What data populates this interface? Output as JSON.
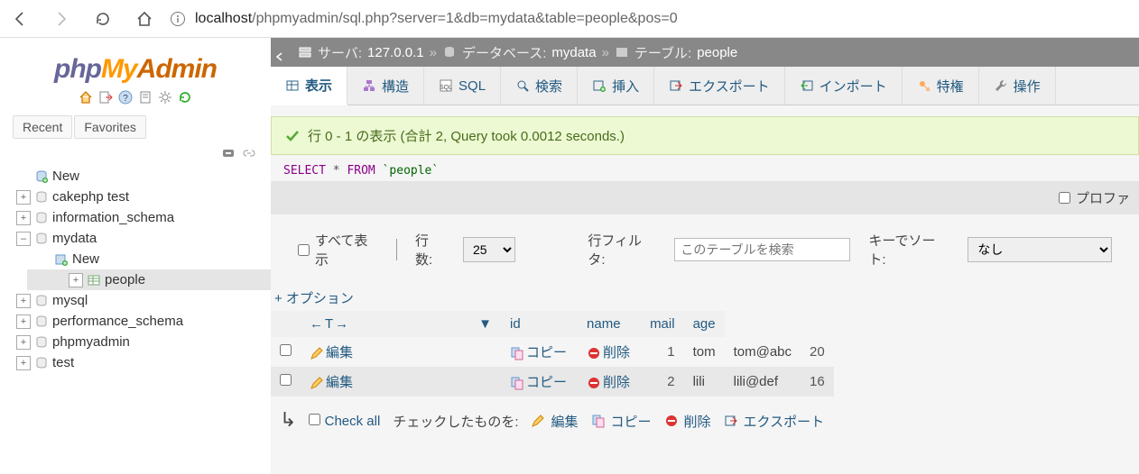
{
  "browser": {
    "url_prefix": "localhost",
    "url_rest": "/phpmyadmin/sql.php?server=1&db=mydata&table=people&pos=0"
  },
  "logo": {
    "part1": "php",
    "part2": "My",
    "part3": "Admin"
  },
  "rf_tabs": {
    "recent": "Recent",
    "favorites": "Favorites"
  },
  "tree": {
    "new": "New",
    "dbs": [
      {
        "name": "cakephp test",
        "expanded": false
      },
      {
        "name": "information_schema",
        "expanded": false
      },
      {
        "name": "mydata",
        "expanded": true,
        "children": {
          "new": "New",
          "tables": [
            "people"
          ]
        }
      },
      {
        "name": "mysql",
        "expanded": false
      },
      {
        "name": "performance_schema",
        "expanded": false
      },
      {
        "name": "phpmyadmin",
        "expanded": false
      },
      {
        "name": "test",
        "expanded": false
      }
    ]
  },
  "breadcrumb": {
    "server_label": "サーバ:",
    "server": "127.0.0.1",
    "db_label": "データベース:",
    "db": "mydata",
    "table_label": "テーブル:",
    "table": "people"
  },
  "tabs": {
    "browse": "表示",
    "structure": "構造",
    "sql": "SQL",
    "search": "検索",
    "insert": "挿入",
    "export": "エクスポート",
    "import": "インポート",
    "privileges": "特権",
    "operations": "操作"
  },
  "message": "行 0 - 1 の表示 (合計 2, Query took 0.0012 seconds.)",
  "sql": {
    "kw1": "SELECT",
    "star": "*",
    "kw2": "FROM",
    "table": "`people`"
  },
  "sqlfooter": {
    "profiling": "プロファ"
  },
  "controls": {
    "show_all": "すべて表示",
    "rowcount_label": "行数:",
    "rowcount_value": "25",
    "filter_label": "行フィルタ:",
    "filter_placeholder": "このテーブルを検索",
    "sort_label": "キーでソート:",
    "sort_value": "なし"
  },
  "options": "+ オプション",
  "table": {
    "t_left": "←",
    "t_mid": "T",
    "t_right": "→",
    "headers": {
      "id": "id",
      "name": "name",
      "mail": "mail",
      "age": "age"
    },
    "actions": {
      "edit": "編集",
      "copy": "コピー",
      "delete": "削除"
    },
    "rows": [
      {
        "id": "1",
        "name": "tom",
        "mail": "tom@abc",
        "age": "20"
      },
      {
        "id": "2",
        "name": "lili",
        "mail": "lili@def",
        "age": "16"
      }
    ]
  },
  "bulk": {
    "check_all": "Check all",
    "with_selected": "チェックしたものを:",
    "edit": "編集",
    "copy": "コピー",
    "delete": "削除",
    "export": "エクスポート"
  }
}
